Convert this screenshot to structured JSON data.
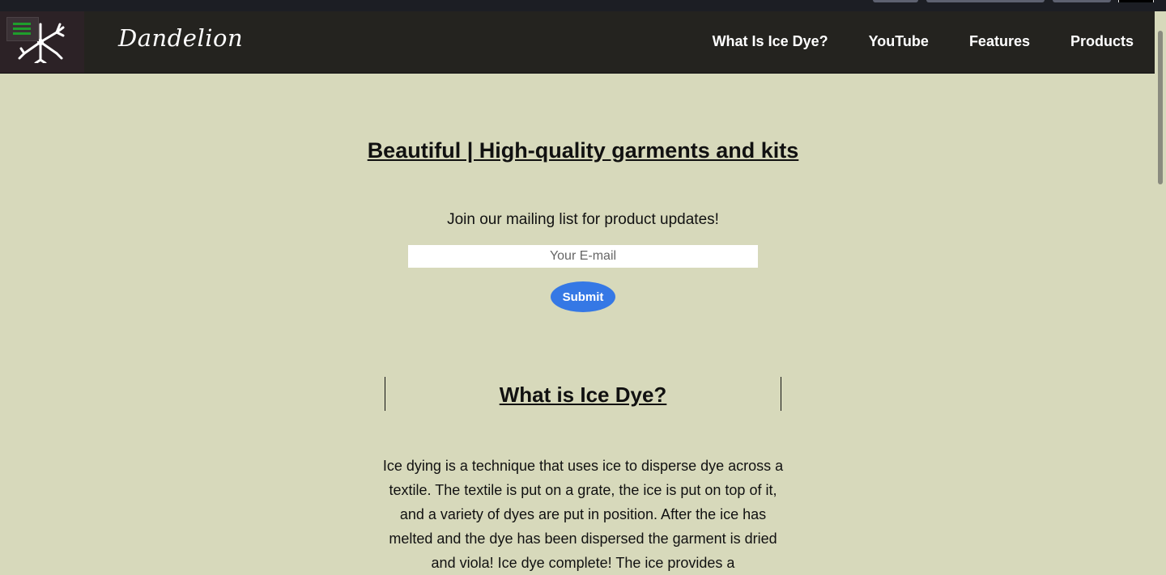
{
  "nav": {
    "brand": "Dandelion",
    "links": [
      "What Is Ice Dye?",
      "YouTube",
      "Features",
      "Products"
    ]
  },
  "hero": {
    "title": "Beautiful | High-quality garments and kits"
  },
  "signup": {
    "prompt": "Join our mailing list for product updates!",
    "email_placeholder": "Your E-mail",
    "submit_label": "Submit"
  },
  "section": {
    "title": "What is Ice Dye?",
    "body": "Ice dying is a technique that uses ice to disperse dye across a textile. The textile is put on a grate, the ice is put on top of it, and a variety of dyes are put in position. After the ice has melted and the dye has been dispersed the garment is dried and viola! Ice dye complete! The ice provides a"
  },
  "colors": {
    "background": "#d7d9bb",
    "navbar": "#24231f",
    "accent": "#3578e5",
    "menu_icon": "#1f9e2c"
  }
}
